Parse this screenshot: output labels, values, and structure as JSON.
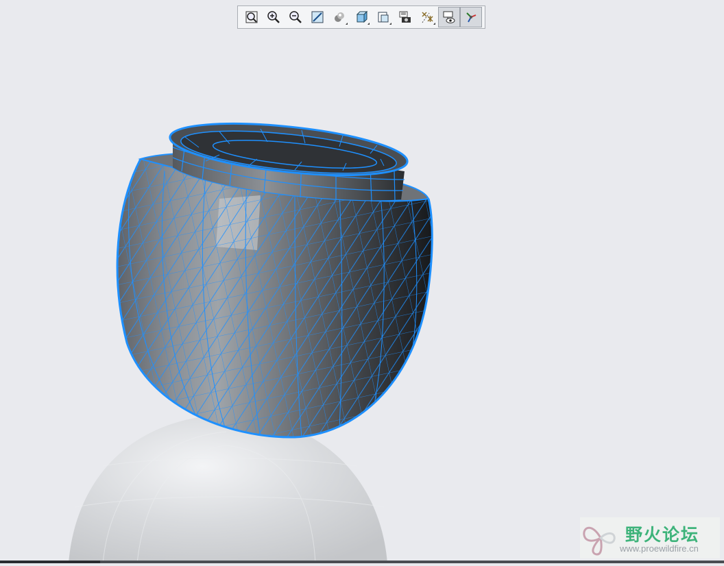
{
  "toolbar": {
    "buttons": [
      {
        "name": "refit-button",
        "icon": "refit-icon"
      },
      {
        "name": "zoom-in-button",
        "icon": "zoom-in-icon"
      },
      {
        "name": "zoom-out-button",
        "icon": "zoom-out-icon"
      },
      {
        "name": "repaint-button",
        "icon": "repaint-icon"
      },
      {
        "name": "display-style-button",
        "icon": "display-style-icon"
      },
      {
        "name": "saved-orientations-button",
        "icon": "cube-icon"
      },
      {
        "name": "view-manager-button",
        "icon": "view-manager-icon"
      },
      {
        "name": "section-button",
        "icon": "camera-icon"
      },
      {
        "name": "datum-display-button",
        "icon": "datum-display-icon"
      },
      {
        "name": "annotation-display-button",
        "icon": "annotation-display-icon"
      },
      {
        "name": "spin-center-button",
        "icon": "spin-center-icon"
      }
    ]
  },
  "watermark": {
    "name": "野火论坛",
    "url": "www.proewildfire.cn"
  },
  "colors": {
    "background": "#e9eaee",
    "mesh": "#1e90ff",
    "model_dark": "#2a2d31",
    "model_light": "#a9adb3"
  }
}
